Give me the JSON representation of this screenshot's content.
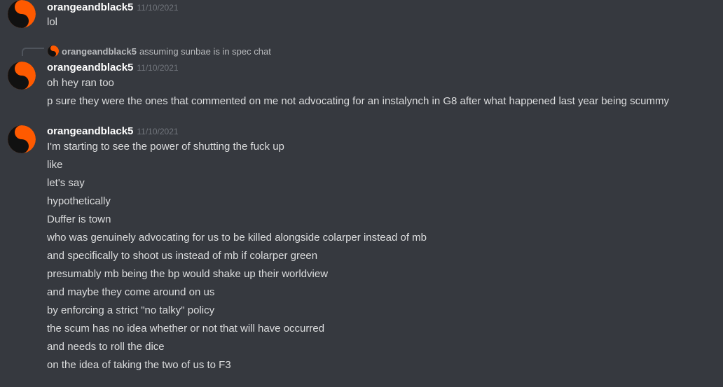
{
  "colors": {
    "background": "#36393f",
    "avatar_orange": "#ff5a00",
    "avatar_black": "#111111",
    "username": "#ffffff",
    "timestamp": "#72767d",
    "text": "#dcddde"
  },
  "avatar_icon": "yin-yang-icon",
  "messages": [
    {
      "username": "orangeandblack5",
      "timestamp": "11/10/2021",
      "lines": [
        "lol"
      ]
    },
    {
      "reply": {
        "username": "orangeandblack5",
        "text": "assuming sunbae is in spec chat"
      },
      "username": "orangeandblack5",
      "timestamp": "11/10/2021",
      "lines": [
        "oh hey ran too",
        "p sure they were the ones that commented on me not advocating for an instalynch in G8 after what happened last year being scummy"
      ]
    },
    {
      "username": "orangeandblack5",
      "timestamp": "11/10/2021",
      "lines": [
        "I'm starting to see the power of shutting the fuck up",
        "like",
        "let's say",
        "hypothetically",
        "Duffer is town",
        "who was genuinely advocating for us to be killed alongside colarper instead of mb",
        "and specifically to shoot us instead of mb if colarper green",
        "presumably mb being the bp would shake up their worldview",
        "and maybe they come around on us",
        "by enforcing a strict \"no talky\" policy",
        "the scum has no idea whether or not that will have occurred",
        "and needs to roll the dice",
        "on the idea of taking the two of us to F3"
      ]
    }
  ]
}
